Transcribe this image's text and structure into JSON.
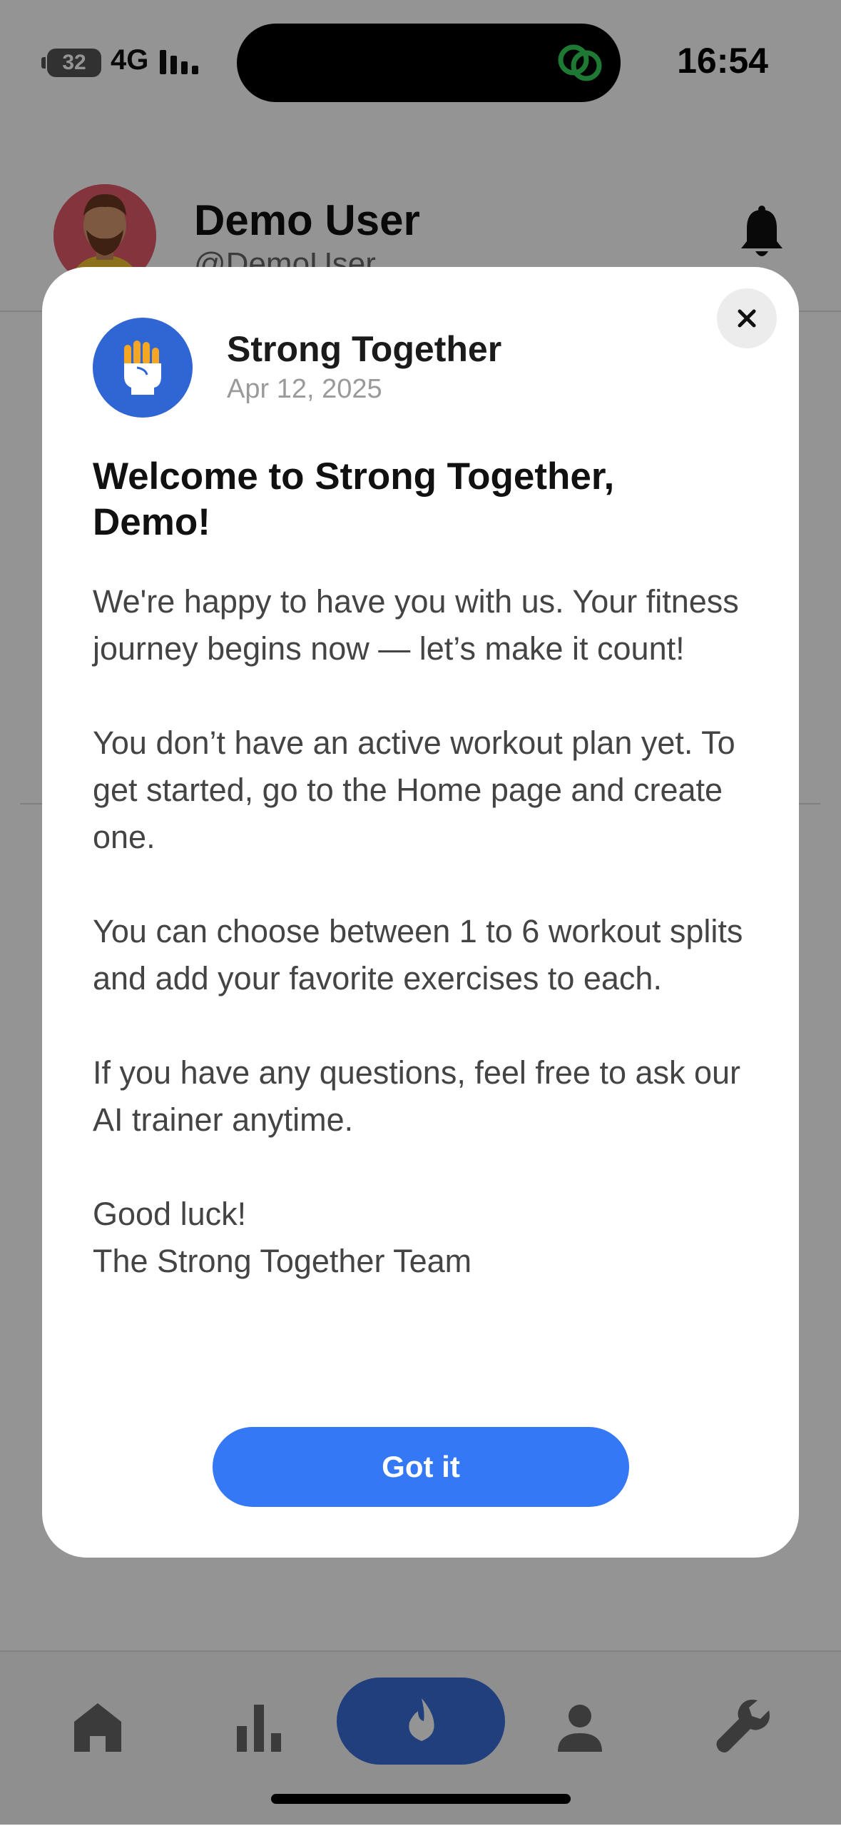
{
  "status_bar": {
    "battery": "32",
    "network": "4G",
    "time": "16:54"
  },
  "header": {
    "name": "Demo User",
    "handle": "@DemoUser"
  },
  "modal": {
    "sender": "Strong Together",
    "date": "Apr 12, 2025",
    "title": "Welcome to Strong Together, Demo!",
    "paragraphs": [
      "We're happy to have you with us. Your fitness journey begins now — let’s make it count!",
      "You don’t have an active workout plan yet. To get started, go to the Home page and create one.",
      "You can choose between 1 to 6 workout splits and add your favorite exercises to each.",
      "If you have any questions, feel free to ask our AI trainer anytime."
    ],
    "signoff_line1": "Good luck!",
    "signoff_line2": "The Strong Together Team",
    "button_label": "Got it"
  },
  "tabs": [
    "home-icon",
    "chart-icon",
    "flame-icon",
    "profile-icon",
    "wrench-icon"
  ],
  "colors": {
    "primary": "#3478f6",
    "logo_bg": "#2f66d4",
    "active_tab": "#3a6cd8",
    "island_icon": "#32d158"
  }
}
